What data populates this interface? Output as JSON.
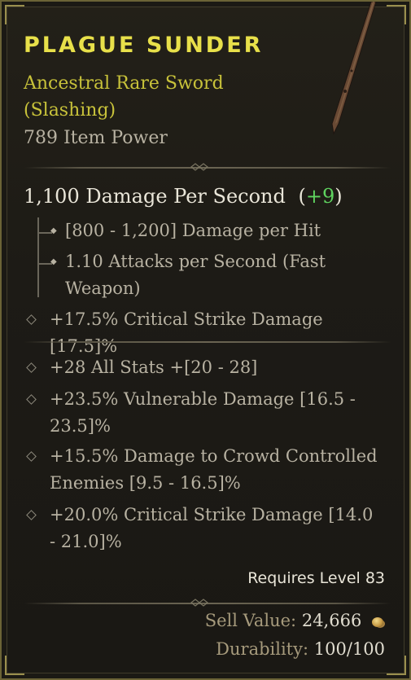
{
  "item": {
    "name": "PLAGUE SUNDER",
    "type_line1": "Ancestral Rare Sword",
    "type_line2": "(Slashing)",
    "item_power": "789 Item Power"
  },
  "weapon": {
    "dps_text": "1,100 Damage Per Second",
    "dps_open": "(",
    "dps_bonus": "+9",
    "dps_close": ")",
    "sub_stats": [
      "[800 - 1,200] Damage per Hit",
      "1.10 Attacks per Second (Fast Weapon)"
    ],
    "implicit": "+17.5% Critical Strike Damage [17.5]%"
  },
  "affixes": [
    "+28 All Stats +[20 - 28]",
    "+23.5% Vulnerable Damage [16.5 - 23.5]%",
    "+15.5% Damage to Crowd Controlled Enemies [9.5 - 16.5]%",
    "+20.0% Critical Strike Damage [14.0 - 21.0]%"
  ],
  "footer": {
    "requires": "Requires Level 83",
    "sell_label": "Sell Value:",
    "sell_value": "24,666",
    "durability_label": "Durability:",
    "durability_value": "100/100"
  },
  "icons": {
    "gold": "gold-coin-icon",
    "bullet": "diamond-bullet-icon",
    "branch": "branch-arrow-icon"
  },
  "colors": {
    "name": "#e8e04a",
    "type": "#c8c23a",
    "bonus": "#5fd35f",
    "border": "#6b6336"
  }
}
